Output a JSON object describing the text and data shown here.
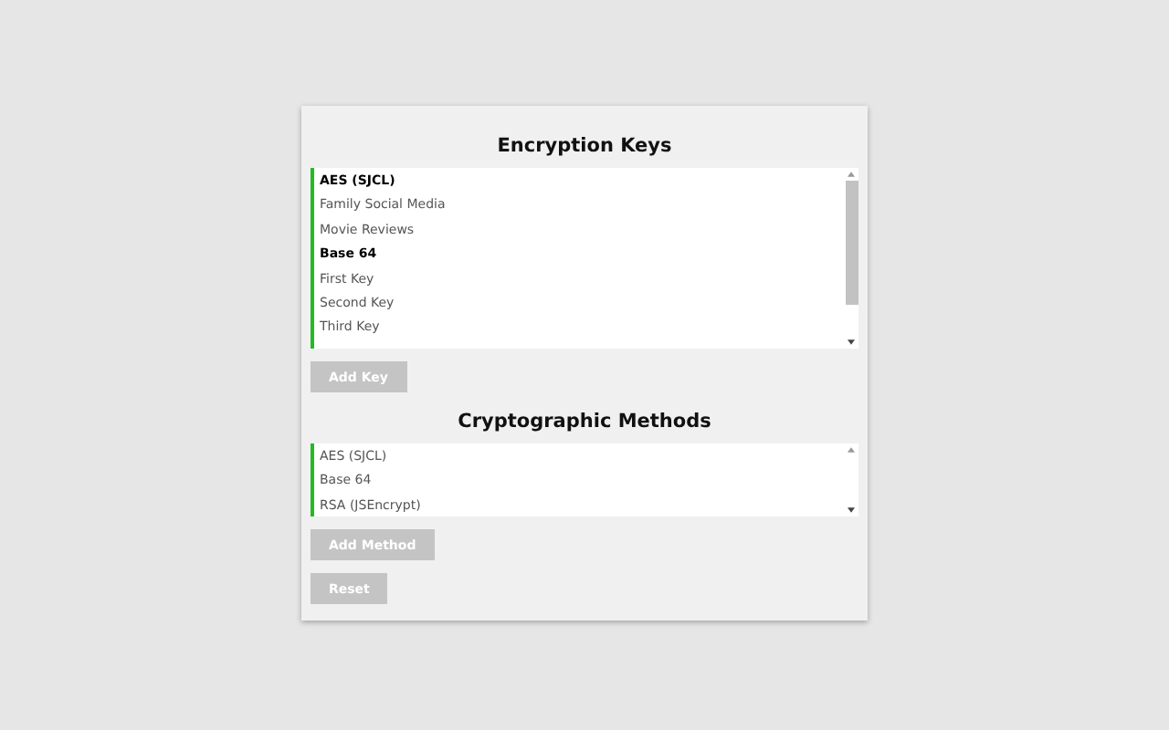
{
  "keys_section": {
    "title": "Encryption Keys",
    "items": [
      {
        "label": "AES (SJCL)",
        "kind": "group"
      },
      {
        "label": "Family Social Media",
        "kind": "item"
      },
      {
        "label": "Movie Reviews",
        "kind": "item"
      },
      {
        "label": "Base 64",
        "kind": "group"
      },
      {
        "label": "First Key",
        "kind": "item"
      },
      {
        "label": "Second Key",
        "kind": "item"
      },
      {
        "label": "Third Key",
        "kind": "item"
      }
    ],
    "button": "Add Key"
  },
  "methods_section": {
    "title": "Cryptographic Methods",
    "items": [
      {
        "label": "AES (SJCL)"
      },
      {
        "label": "Base 64"
      },
      {
        "label": "RSA (JSEncrypt)"
      }
    ],
    "button": "Add Method"
  },
  "reset_button": "Reset"
}
